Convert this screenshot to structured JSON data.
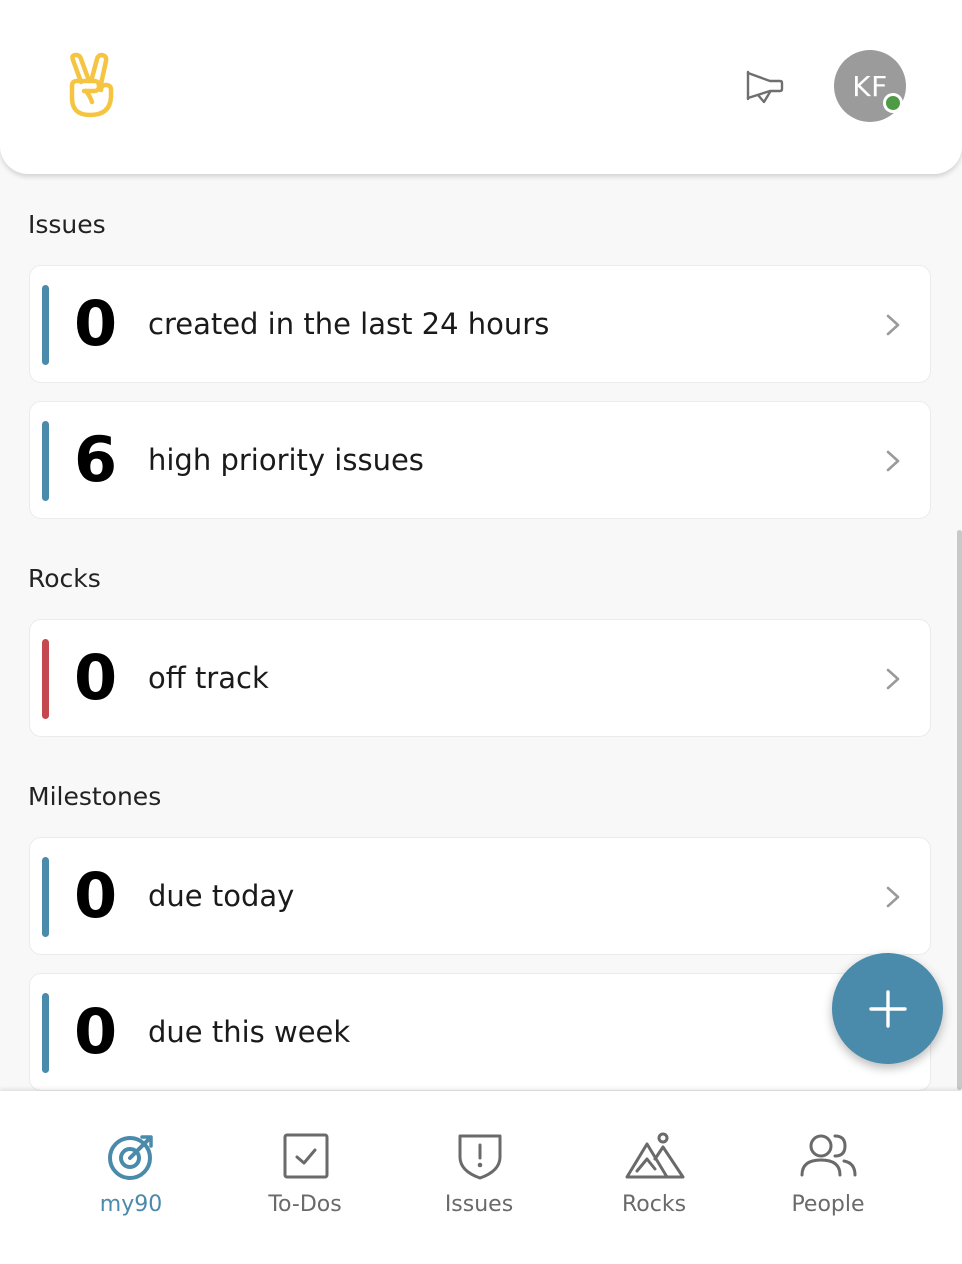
{
  "header": {
    "logo_icon": "peace-hand-icon",
    "announcement_icon": "megaphone-icon",
    "avatar_initials": "KF",
    "presence_status_color": "#4f9a44"
  },
  "colors": {
    "brand_blue": "#4a8aaa",
    "off_track_red": "#c4484f",
    "logo_yellow": "#f5c542"
  },
  "sections": {
    "issues": {
      "title": "Issues",
      "cards": [
        {
          "count": "0",
          "label": "created in the last 24 hours",
          "stripe_color": "#4a8aaa"
        },
        {
          "count": "6",
          "label": "high priority issues",
          "stripe_color": "#4a8aaa"
        }
      ]
    },
    "rocks": {
      "title": "Rocks",
      "cards": [
        {
          "count": "0",
          "label": "off track",
          "stripe_color": "#c4484f"
        }
      ]
    },
    "milestones": {
      "title": "Milestones",
      "cards": [
        {
          "count": "0",
          "label": "due today",
          "stripe_color": "#4a8aaa"
        },
        {
          "count": "0",
          "label": "due this week",
          "stripe_color": "#4a8aaa"
        }
      ]
    }
  },
  "fab": {
    "icon": "plus-icon"
  },
  "bottom_nav": {
    "items": [
      {
        "label": "my90",
        "icon": "target-icon",
        "active": true
      },
      {
        "label": "To-Dos",
        "icon": "checkbox-icon",
        "active": false
      },
      {
        "label": "Issues",
        "icon": "shield-alert-icon",
        "active": false
      },
      {
        "label": "Rocks",
        "icon": "mountains-icon",
        "active": false
      },
      {
        "label": "People",
        "icon": "people-icon",
        "active": false
      }
    ]
  }
}
